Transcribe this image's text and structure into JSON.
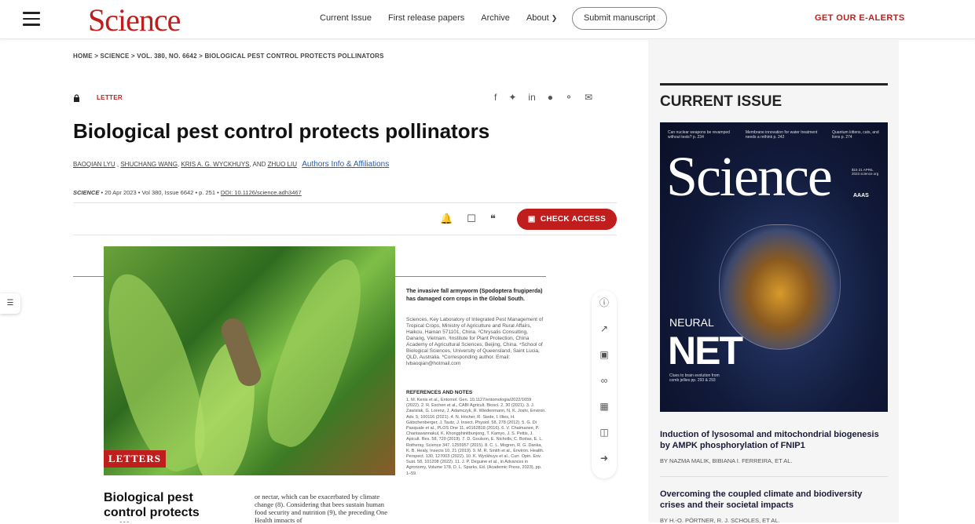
{
  "header": {
    "logo": "Science",
    "nav": [
      "Current Issue",
      "First release papers",
      "Archive",
      "About"
    ],
    "submit": "Submit manuscript",
    "alerts": "GET OUR E-ALERTS"
  },
  "breadcrumb": "HOME  >  SCIENCE  >  VOL. 380, NO. 6642  >  BIOLOGICAL PEST CONTROL PROTECTS POLLINATORS",
  "article": {
    "type": "LETTER",
    "title": "Biological pest control protects pollinators",
    "authors": [
      "BAOQIAN LYU",
      "SHUCHANG WANG",
      "KRIS A. G. WYCKHUYS",
      "ZHUO LIU"
    ],
    "authors_sep1": " , ",
    "authors_sep2": ", ",
    "authors_and": ", AND ",
    "affiliations_link": "Authors Info & Affiliations",
    "journal": "SCIENCE",
    "date": "20 Apr 2023",
    "volume": "Vol 380, Issue 6642",
    "page": "p. 251",
    "doi": "DOI: 10.1126/science.adh3467",
    "dot": "•",
    "check_access": "CHECK ACCESS"
  },
  "figure": {
    "label": "LETTERS",
    "caption_bold": "The invasive fall armyworm (Spodoptera frugiperda) has damaged corn crops in the Global South.",
    "affiliations": "Sciences, Key Laboratory of Integrated Pest Management of Tropical Crops, Ministry of Agriculture and Rural Affairs, Haikou, Hainan 571101, China. ²Chrysalis Consulting, Danang, Vietnam. ³Institute for Plant Protection, China Academy of Agricultural Sciences, Beijing, China. ⁴School of Biological Sciences, University of Queensland, Saint Lucia, QLD, Australia. *Corresponding author. Email: lvbaoqian@hotmail.com",
    "refs_heading": "REFERENCES AND NOTES",
    "refs": "1. M. Kenis et al., Entomol. Gen. 10.1127/entomologia/2022/1659 (2022). 2. R. Eschen et al., CABI Agricult. Biosci. 2, 30 (2021). 3. J. Zawislak, G. Lorenz, J. Adamczyk, R. Wiedenmann, N. K. Joshi, Environ. Adv. 5, 100116 (2021). 4. N. Höcher, R. Siede, I. Illies, H. Gätschenberger, J. Tautz, J. Insect. Physiol. 58, 278 (2012). 5. G. Di Pasquale et al., PLOS One 11, e0162818 (2016). 6. V. Chaimanee, P. Chantawannakul, K. Khongphinitbunjong, T. Kamyo, J. S. Pettis, J. Apicult. Res. 58, 720 (2019). 7. D. Goulson, E. Nicholls, C. Botías, E. L. Rotheray, Science 347, 1255957 (2015). 8. C. L. Mogren, R. G. Danka, K. B. Healy, Insects 10, 21 (2019). 9. M. R. Smith et al., Environ. Health. Perspect. 130, 127003 (2022). 10. K. Wyckhuys et al., Curr. Opin. Env. Sust. 58, 101208 (2022). 11. J. P. Deguine et al., in Advances in Agronomy, Volume 178, D. L. Sparks, Ed. (Academic Press, 2023), pp. 1–59.",
    "title": "Biological pest control protects pollinators",
    "body": "or nectar, which can be exacerbated by climate change (8). Considering that bees sustain human food security and nutrition (9), the preceding One Health impacts of"
  },
  "sidebar": {
    "heading": "CURRENT ISSUE",
    "cover": {
      "teasers": [
        "Can nuclear weapons be revamped without tests? p. 234",
        "Membrane innovation for water treatment needs a rethink p. 242",
        "Quantum kittens, cats, and lions p. 274"
      ],
      "masthead": "Science",
      "date": "$15 21 APRIL 2023 science.org",
      "aaas": "AAAS",
      "neural": "NEURAL",
      "net": "NET",
      "clue": "Clues to brain evolution from comb jellies pp. 293 & 293"
    },
    "articles": [
      {
        "title": "Induction of lysosomal and mitochondrial biogenesis by AMPK phosphorylation of FNIP1",
        "by": "BY NAZMA MALIK, BIBIANA I. FERREIRA, ET AL."
      },
      {
        "title": "Overcoming the coupled climate and biodiversity crises and their societal impacts",
        "by": "BY H.-O. PÖRTNER, R. J. SCHOLES, ET AL."
      }
    ]
  }
}
